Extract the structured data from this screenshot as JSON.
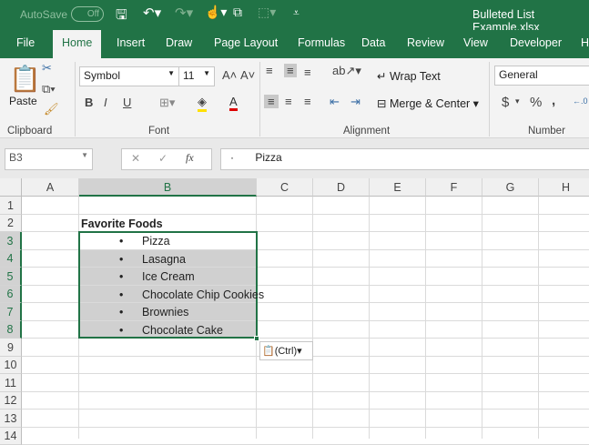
{
  "title_bar": {
    "autosave_label": "AutoSave",
    "autosave_state": "Off",
    "filename": "Bulleted List Example.xlsx"
  },
  "tabs": [
    "File",
    "Home",
    "Insert",
    "Draw",
    "Page Layout",
    "Formulas",
    "Data",
    "Review",
    "View",
    "Developer",
    "H"
  ],
  "active_tab": "Home",
  "ribbon": {
    "paste_label": "Paste",
    "font_name": "Symbol",
    "font_size": "11",
    "bold": "B",
    "italic": "I",
    "underline": "U",
    "wrap_text": "Wrap Text",
    "merge_center": "Merge & Center",
    "number_format": "General",
    "currency": "$",
    "percent": "%",
    "comma": ",",
    "groups": [
      "Clipboard",
      "Font",
      "Alignment",
      "Number"
    ]
  },
  "formula_bar": {
    "name_box": "B3",
    "fx": "fx",
    "content": "·       Pizza"
  },
  "columns": [
    "A",
    "B",
    "C",
    "D",
    "E",
    "F",
    "G",
    "H"
  ],
  "rows": [
    "1",
    "2",
    "3",
    "4",
    "5",
    "6",
    "7",
    "8",
    "9",
    "10",
    "11",
    "12",
    "13",
    "14"
  ],
  "cells": {
    "B2": "Favorite Foods",
    "bullet": "•",
    "list": [
      "Pizza",
      "Lasagna",
      "Ice Cream",
      "Chocolate Chip Cookies",
      "Brownies",
      "Chocolate Cake"
    ]
  },
  "paste_options": "(Ctrl)",
  "colors": {
    "accent": "#217346",
    "selection": "#d0d0d0"
  }
}
